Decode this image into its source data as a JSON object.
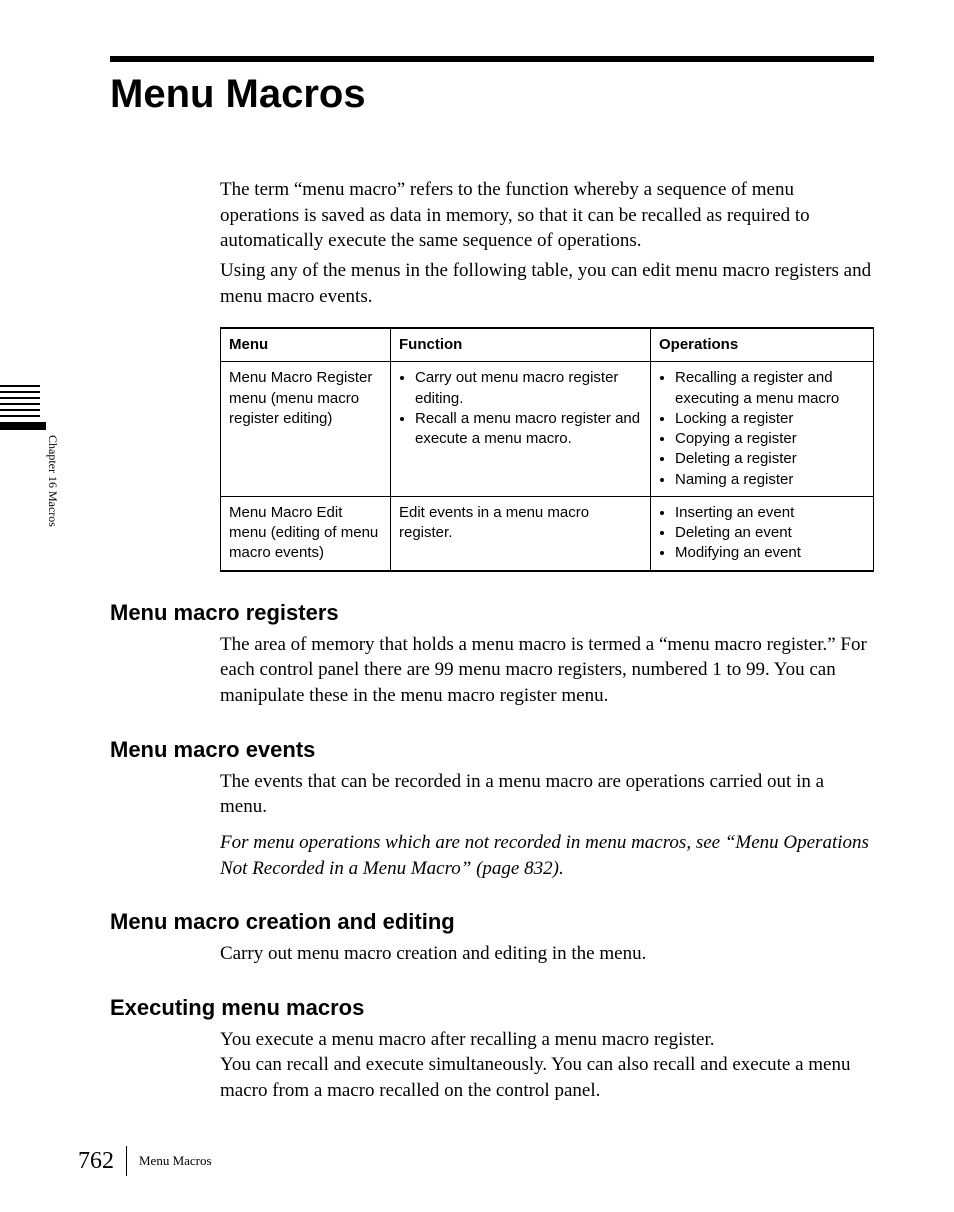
{
  "title": "Menu Macros",
  "intro": {
    "p1": "The term “menu macro” refers to the function whereby a sequence of menu operations is saved as data in memory, so that it can be recalled as required to automatically execute the same sequence of operations.",
    "p2": "Using any of the menus in the following table, you can edit menu macro registers and menu macro events."
  },
  "table": {
    "headers": {
      "menu": "Menu",
      "function": "Function",
      "operations": "Operations"
    },
    "rows": [
      {
        "menu": "Menu Macro Register menu (menu macro register editing)",
        "function": [
          "Carry out menu macro register editing.",
          "Recall a menu macro register and execute a menu macro."
        ],
        "operations": [
          "Recalling a register and executing a menu macro",
          "Locking a register",
          "Copying a register",
          "Deleting a register",
          "Naming a register"
        ]
      },
      {
        "menu": "Menu Macro Edit menu (editing of menu macro events)",
        "function_text": "Edit events in a menu macro register.",
        "operations": [
          "Inserting an event",
          "Deleting an event",
          "Modifying an event"
        ]
      }
    ]
  },
  "sections": {
    "registers": {
      "heading": "Menu macro registers",
      "body": "The area of memory that holds a menu macro is termed a “menu macro register.” For each control panel there are 99 menu macro registers, numbered 1 to 99. You can manipulate these in the menu macro register menu."
    },
    "events": {
      "heading": "Menu macro events",
      "body1": "The events that can be recorded in a menu macro are operations carried out in a menu.",
      "body2": "For menu operations which are not recorded in menu macros, see “Menu Operations Not Recorded in a Menu Macro” (page 832)."
    },
    "creation": {
      "heading": "Menu macro creation and editing",
      "body": "Carry out menu macro creation and editing in the menu."
    },
    "executing": {
      "heading": "Executing menu macros",
      "body": "You execute a menu macro after recalling a menu macro register.\nYou can recall and execute simultaneously. You can also recall and execute a menu macro from a macro recalled on the control panel."
    }
  },
  "sidebar": {
    "label": "Chapter 16  Macros"
  },
  "footer": {
    "page": "762",
    "title": "Menu Macros"
  }
}
